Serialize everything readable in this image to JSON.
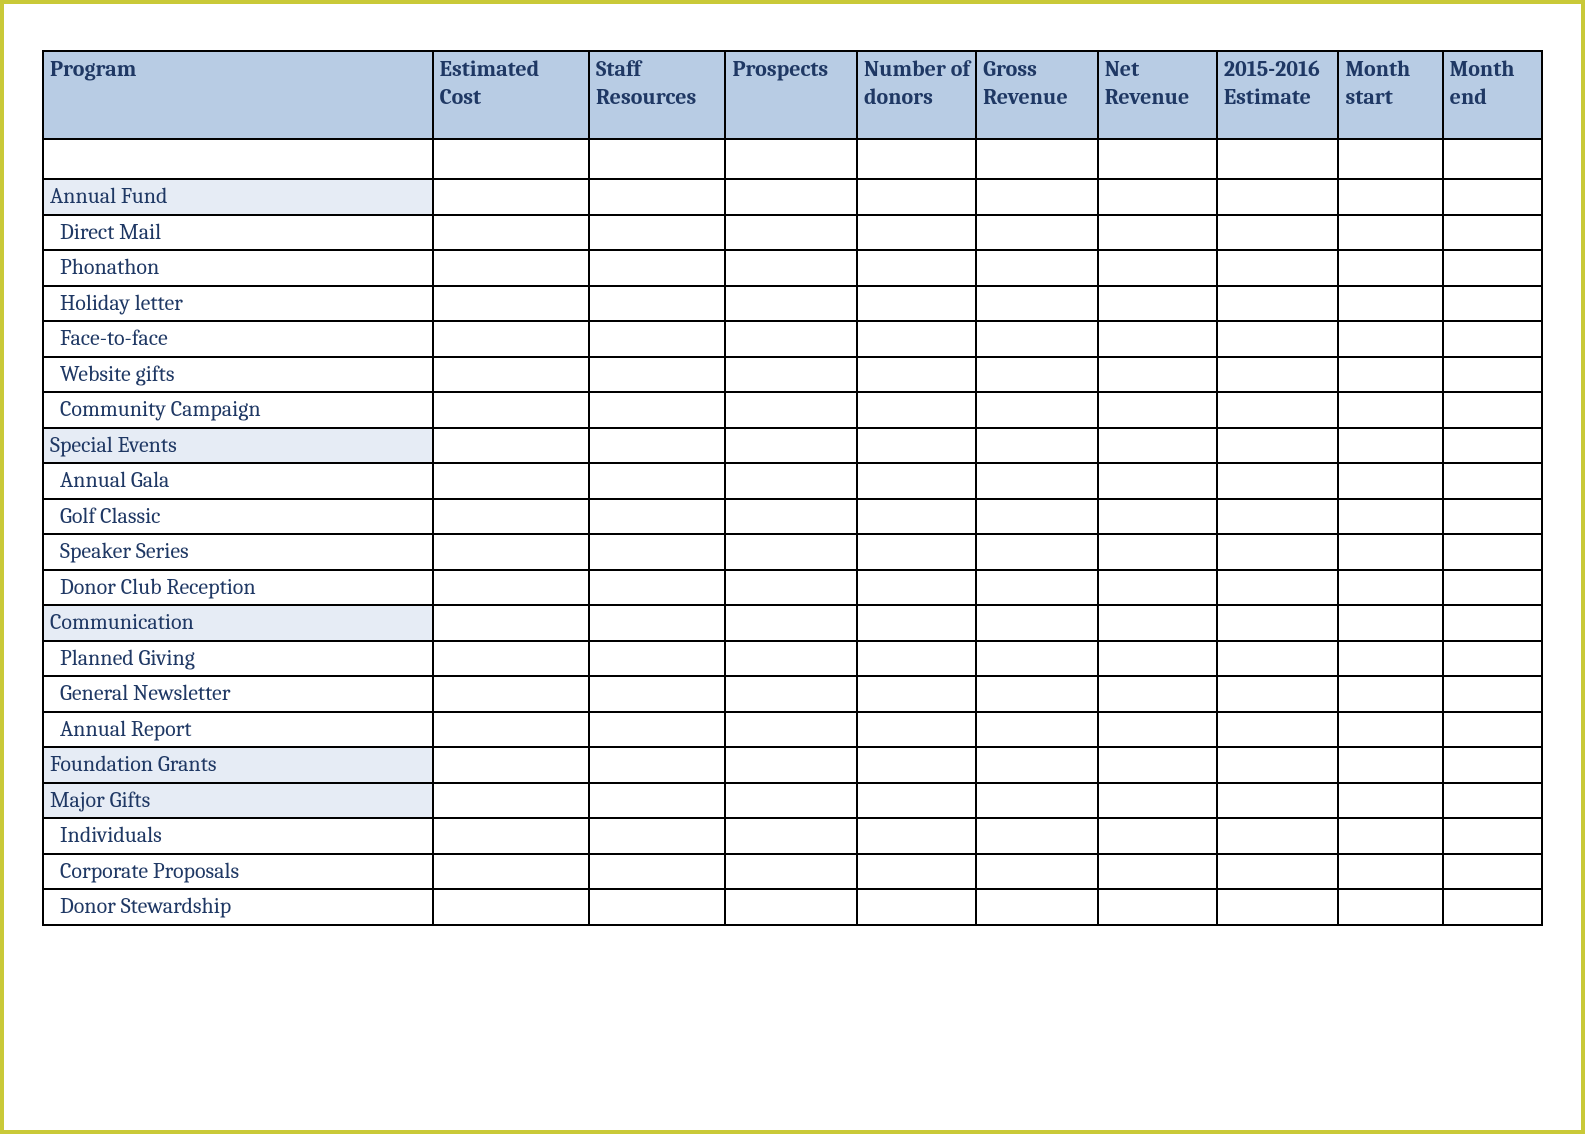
{
  "headers": [
    "Program",
    "Estimated Cost",
    "Staff Resources",
    "Prospects",
    "Number of donors",
    "Gross Revenue",
    "Net Revenue",
    "2015-2016 Estimate",
    "Month start",
    "Month end"
  ],
  "rows": [
    {
      "type": "spacer",
      "label": ""
    },
    {
      "type": "category",
      "label": "Annual Fund"
    },
    {
      "type": "item",
      "label": "Direct Mail"
    },
    {
      "type": "item",
      "label": "Phonathon"
    },
    {
      "type": "item",
      "label": "Holiday letter"
    },
    {
      "type": "item",
      "label": "Face-to-face"
    },
    {
      "type": "item",
      "label": "Website gifts"
    },
    {
      "type": "item",
      "label": "Community Campaign"
    },
    {
      "type": "category",
      "label": "Special Events"
    },
    {
      "type": "item",
      "label": "Annual Gala"
    },
    {
      "type": "item",
      "label": "Golf Classic"
    },
    {
      "type": "item",
      "label": "Speaker Series"
    },
    {
      "type": "item",
      "label": "Donor Club Reception"
    },
    {
      "type": "category",
      "label": "Communication"
    },
    {
      "type": "item",
      "label": "Planned Giving"
    },
    {
      "type": "item",
      "label": "General Newsletter"
    },
    {
      "type": "item",
      "label": "Annual Report"
    },
    {
      "type": "category",
      "label": "Foundation Grants"
    },
    {
      "type": "category",
      "label": "Major Gifts"
    },
    {
      "type": "item",
      "label": "Individuals"
    },
    {
      "type": "item",
      "label": "Corporate Proposals"
    },
    {
      "type": "item",
      "label": "Donor Stewardship"
    }
  ]
}
